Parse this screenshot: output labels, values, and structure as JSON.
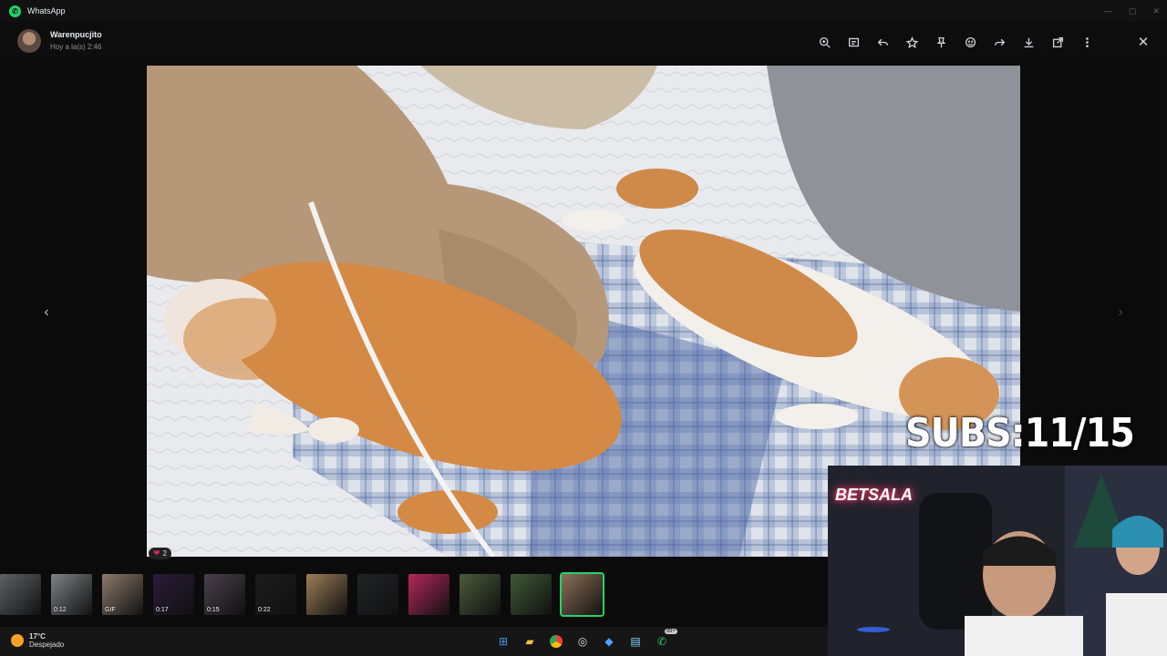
{
  "window": {
    "title": "WhatsApp",
    "accent": "#25d366"
  },
  "header": {
    "contact_name": "Warenpucjito",
    "timestamp": "Hoy a la(s) 2:46"
  },
  "toolbar": {
    "icons": [
      "zoom-in-icon",
      "caption-icon",
      "reply-icon",
      "star-icon",
      "pin-icon",
      "react-emoji-icon",
      "forward-icon",
      "download-icon",
      "open-external-icon",
      "more-icon",
      "close-icon"
    ],
    "close_glyph": "✕"
  },
  "viewer": {
    "prev_glyph": "‹",
    "next_glyph": "›",
    "reaction": {
      "emoji": "❤",
      "count": "2"
    }
  },
  "thumbnails": [
    {
      "duration": "",
      "color": "#5e6166"
    },
    {
      "duration": "0:12",
      "color": "#7f8186"
    },
    {
      "duration": "GIF",
      "color": "#8d7a6b"
    },
    {
      "duration": "0:17",
      "color": "#2a1b3a"
    },
    {
      "duration": "0:15",
      "color": "#4a3f4c"
    },
    {
      "duration": "0:22",
      "color": "#1c1c1c"
    },
    {
      "duration": "",
      "color": "#9c7d55"
    },
    {
      "duration": "",
      "color": "#222326"
    },
    {
      "duration": "",
      "color": "#b4285a"
    },
    {
      "duration": "",
      "color": "#4a5b3a"
    },
    {
      "duration": "",
      "color": "#3e5a36"
    },
    {
      "duration": "",
      "color": "#8c7058",
      "selected": true
    }
  ],
  "taskbar": {
    "weather_temp": "17°C",
    "weather_desc": "Despejado",
    "badge": "99+"
  },
  "overlay": {
    "subs": "SUBS:11/15",
    "webcam_sign": "BETSALA"
  }
}
